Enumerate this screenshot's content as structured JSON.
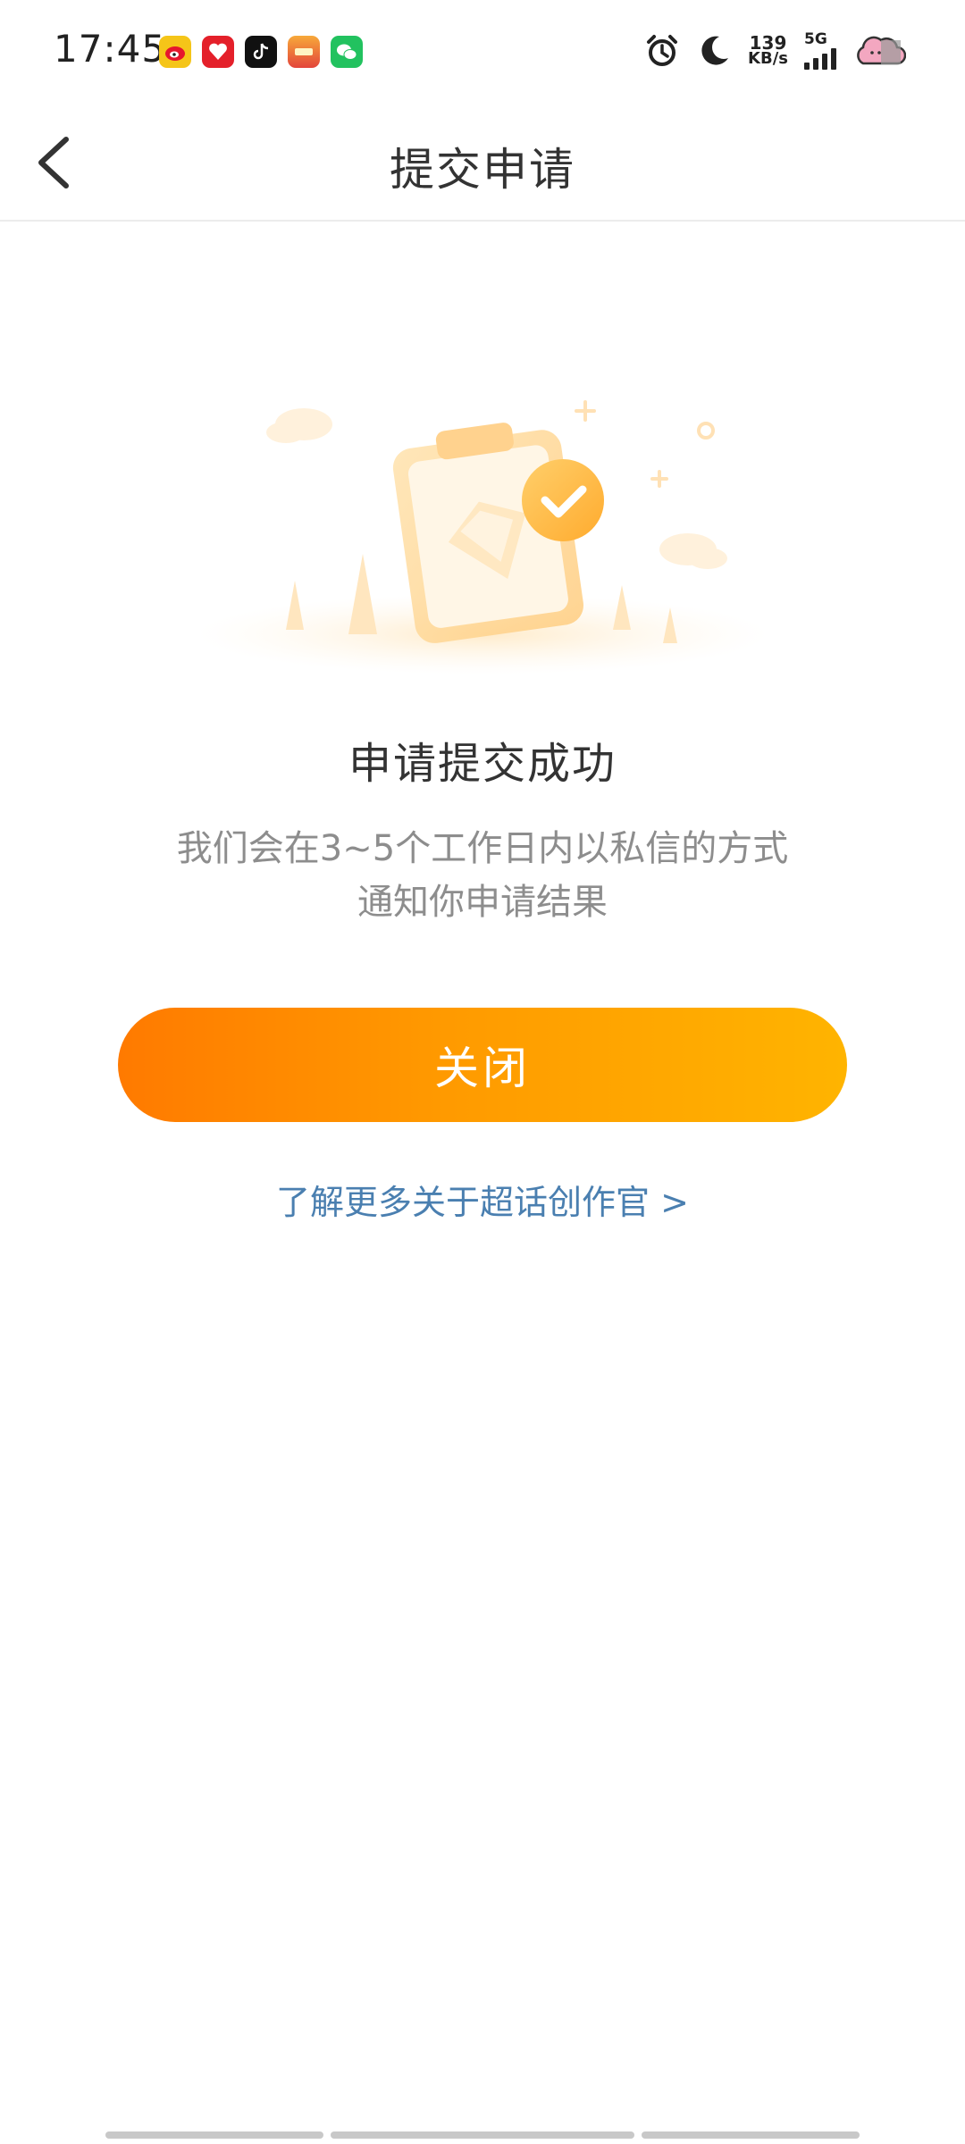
{
  "status_bar": {
    "time": "17:45",
    "net_speed_value": "139",
    "net_speed_unit": "KB/s",
    "network_type": "5G",
    "app_icons": [
      "weibo-icon",
      "red-app-icon",
      "tiktok-icon",
      "game-app-icon",
      "wechat-icon"
    ]
  },
  "nav": {
    "title": "提交申请"
  },
  "result": {
    "title": "申请提交成功",
    "desc_line1": "我们会在3~5个工作日内以私信的方式",
    "desc_line2": "通知你申请结果"
  },
  "actions": {
    "close_label": "关闭",
    "more_link": "了解更多关于超话创作官 >"
  },
  "colors": {
    "button_start": "#ff7a00",
    "button_end": "#ffb400",
    "link": "#4a7fb0",
    "muted_text": "#8d8d8d"
  }
}
